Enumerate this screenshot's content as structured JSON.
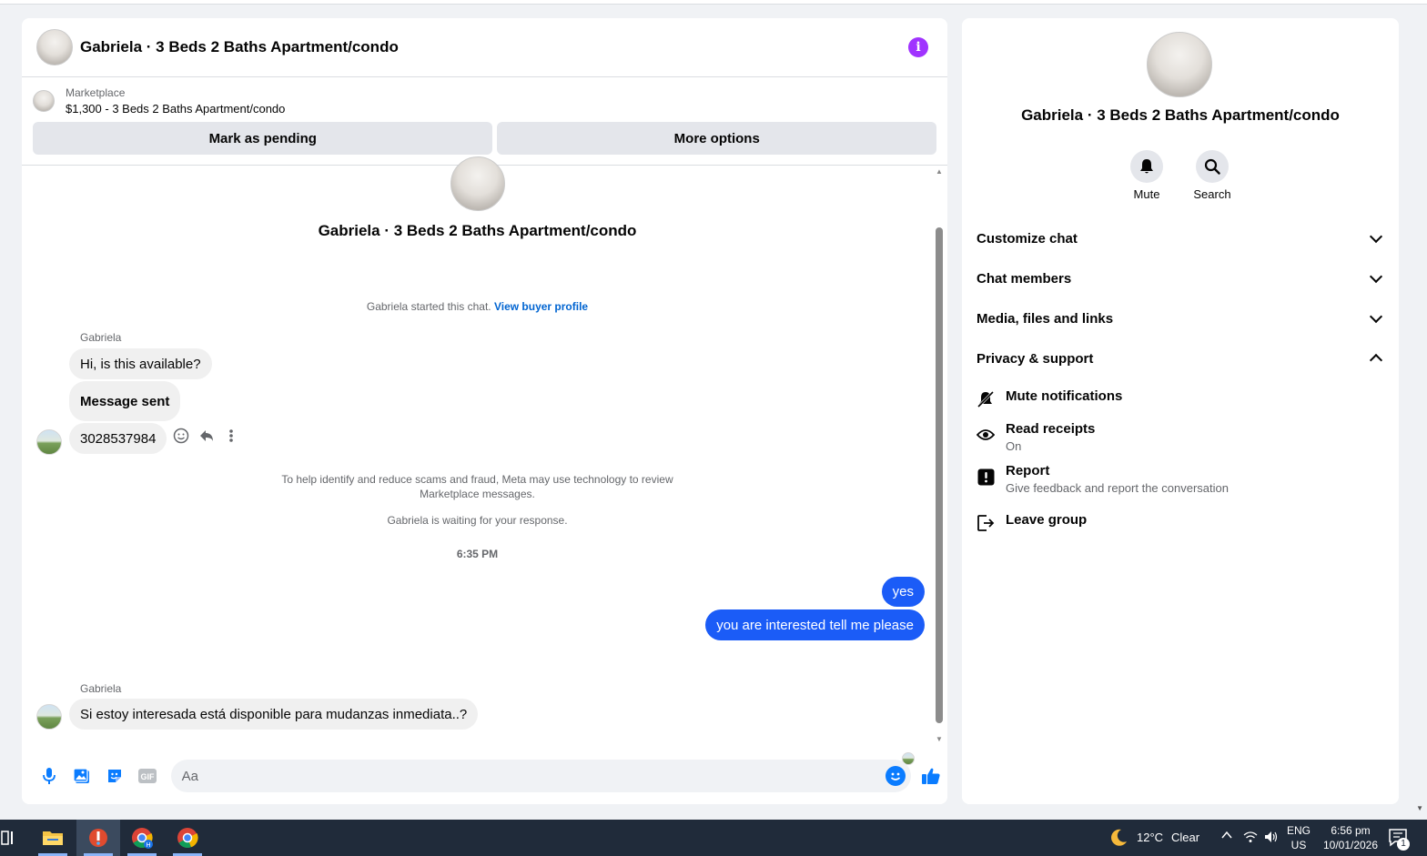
{
  "chat": {
    "header_title": "Gabriela · 3 Beds 2 Baths Apartment/condo",
    "listing": {
      "source": "Marketplace",
      "summary": "$1,300 - 3 Beds 2 Baths Apartment/condo",
      "pending_button": "Mark as pending",
      "more_button": "More options"
    },
    "thread_title": "Gabriela · 3 Beds 2 Baths Apartment/condo",
    "started_text": "Gabriela started this chat.",
    "buyer_link": "View buyer profile",
    "messages_group1": {
      "sender": "Gabriela",
      "msg1": "Hi, is this available?",
      "msg2": "Message sent",
      "msg3": "3028537984"
    },
    "notice_line1": "To help identify and reduce scams and fraud, Meta may use technology to review",
    "notice_line2": "Marketplace messages.",
    "waiting_text": "Gabriela is waiting for your response.",
    "timestamp": "6:35 PM",
    "outgoing": {
      "msg1": "yes",
      "msg2": "you are interested tell me please"
    },
    "messages_group2": {
      "sender": "Gabriela",
      "msg1": "Si estoy interesada está disponible para mudanzas inmediata..?"
    },
    "composer_placeholder": "Aa"
  },
  "side": {
    "title": "Gabriela · 3 Beds 2 Baths Apartment/condo",
    "mute_label": "Mute",
    "search_label": "Search",
    "sections": {
      "customize": "Customize chat",
      "members": "Chat members",
      "media": "Media, files and links",
      "privacy": "Privacy & support"
    },
    "privacy_options": {
      "mute_notifications": "Mute notifications",
      "read_receipts": "Read receipts",
      "read_receipts_status": "On",
      "report": "Report",
      "report_desc": "Give feedback and report the conversation",
      "leave": "Leave group"
    }
  },
  "taskbar": {
    "weather_temp": "12°C",
    "weather_desc": "Clear",
    "lang_top": "ENG",
    "lang_bottom": "US",
    "time": "6:56 pm",
    "date": "10/01/2026",
    "notification_count": "1"
  },
  "colors": {
    "outgoing_bubble": "#1b5cf7",
    "accent": "#0a7cff",
    "info_icon": "#a033ff",
    "taskbar": "#202b3a"
  }
}
